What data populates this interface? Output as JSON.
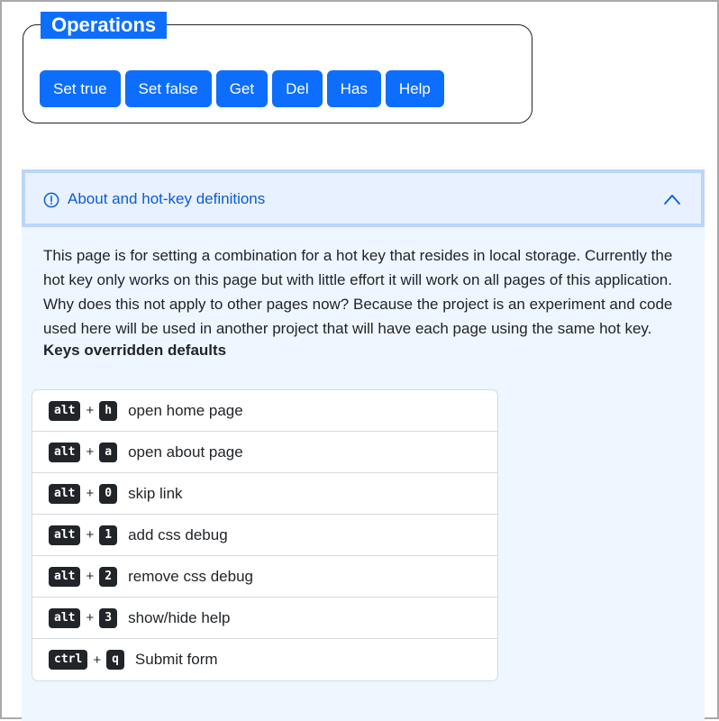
{
  "operations": {
    "legend": "Operations",
    "buttons": [
      "Set true",
      "Set false",
      "Get",
      "Del",
      "Has",
      "Help"
    ]
  },
  "about": {
    "header_title": "About and hot-key definitions",
    "expanded": true,
    "description": "This page is for setting a combination for a hot key that resides in local storage. Currently the hot key only works on this page but with little effort it will work on all pages of this application. Why does this not apply to other pages now? Because the project is an experiment and code used here will be used in another project that will have each page using the same hot key.",
    "keys_title": "Keys overridden defaults",
    "plus": "+",
    "shortcuts": [
      {
        "mod": "alt",
        "key": "h",
        "desc": "open home page"
      },
      {
        "mod": "alt",
        "key": "a",
        "desc": "open about page"
      },
      {
        "mod": "alt",
        "key": "0",
        "desc": "skip link"
      },
      {
        "mod": "alt",
        "key": "1",
        "desc": "add css debug"
      },
      {
        "mod": "alt",
        "key": "2",
        "desc": "remove css debug"
      },
      {
        "mod": "alt",
        "key": "3",
        "desc": "show/hide help"
      },
      {
        "mod": "ctrl",
        "key": "q",
        "desc": "Submit form"
      }
    ]
  },
  "icons": {
    "header_icon": "info-circle-icon",
    "toggle_icon": "chevron-up-icon"
  },
  "colors": {
    "primary": "#0d6efd",
    "accordion_bg": "#eef6ff",
    "header_border": "#bcd6fb",
    "kbd_bg": "#212529"
  }
}
